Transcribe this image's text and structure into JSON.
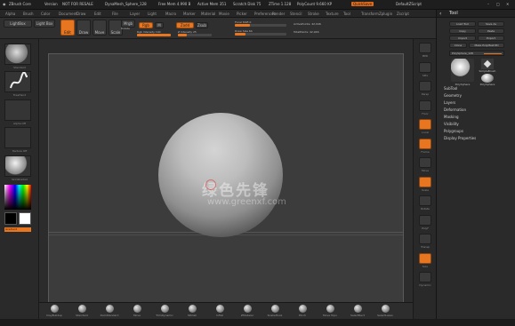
{
  "title_bar": {
    "app": "ZBrush Core",
    "version": "Version",
    "license": "NOT FOR RESALE",
    "doc": "DynaMesh_Sphere_128",
    "free_mem": "Free Mem 4.990 B",
    "active_mem": "Active Mem 351",
    "scratch": "Scratch Disk 75",
    "ztime": "ZTime 1.128",
    "poly": "PolyCount 9.660 KP",
    "quicksave": "QuickSave",
    "default": "DefaultZScript"
  },
  "menu": [
    "Alpha",
    "Brush",
    "Color",
    "Document",
    "Draw",
    "Edit",
    "File",
    "Layer",
    "Light",
    "Macro",
    "Marker",
    "Material",
    "Movie",
    "Picker",
    "Preferences",
    "Render",
    "Stencil",
    "Stroke",
    "Texture",
    "Tool",
    "Transform",
    "Zplugin",
    "Zscript"
  ],
  "toolbar": {
    "left_label": "LightBox",
    "left_hint": "Light Box",
    "edit": "Edit",
    "draw": "Draw",
    "move": "Move",
    "scale": "Scale",
    "rotate": "Rotate",
    "mrgb": "Mrgb",
    "rgb": "Rgb",
    "m": "M",
    "zadd": "Zadd",
    "zsub": "Zsub",
    "focal_label": "Focal Shift 0",
    "draw_size_label": "Draw Size 64",
    "rgb_intensity_label": "Rgb Intensity 100",
    "z_intensity_label": "Z Intensity 25",
    "active_points": "ActivePoints: 42,946",
    "total_points": "TotalPoints: 42,946"
  },
  "left_shelf": {
    "brushes": [
      "Standard",
      "FreeHand",
      "Alpha Off",
      "Texture Off",
      "SkinShade4"
    ],
    "color_label": "Gradient"
  },
  "right_shelf": [
    "BPR",
    "SPix",
    "Persp",
    "Floor",
    "Local",
    "Frame",
    "Move",
    "Scale",
    "Rotate",
    "PolyF",
    "Transp",
    "Solo",
    "Dynamic"
  ],
  "tray": {
    "title": "Tool",
    "buttons": [
      "Load Tool",
      "Save As",
      "Copy",
      "Paste",
      "Import",
      "Export",
      "Clone",
      "Make PolyMesh3D"
    ],
    "current_tool": "PolySphere_128",
    "thumbs": [
      "PolySphere",
      "SimpleBrush",
      "PolySphere"
    ],
    "sections": [
      "SubTool",
      "Geometry",
      "Layers",
      "Deformation",
      "Masking",
      "Visibility",
      "Polygroups",
      "Display Properties"
    ]
  },
  "bottom_brushes": [
    "ClayBuildup",
    "Standard",
    "DamStandard",
    "Move",
    "TrimDynamic",
    "hPolish",
    "Inflat",
    "ZModeler",
    "SnakeHook",
    "Pinch",
    "Move Topo",
    "SelectRect",
    "SelectLasso"
  ],
  "watermark": "www.greenxf.com",
  "watermark_cn": "绿色先锋",
  "colors": {
    "accent": "#e8751f",
    "bg": "#2b2b2b",
    "canvas": "#3c3c3c"
  }
}
